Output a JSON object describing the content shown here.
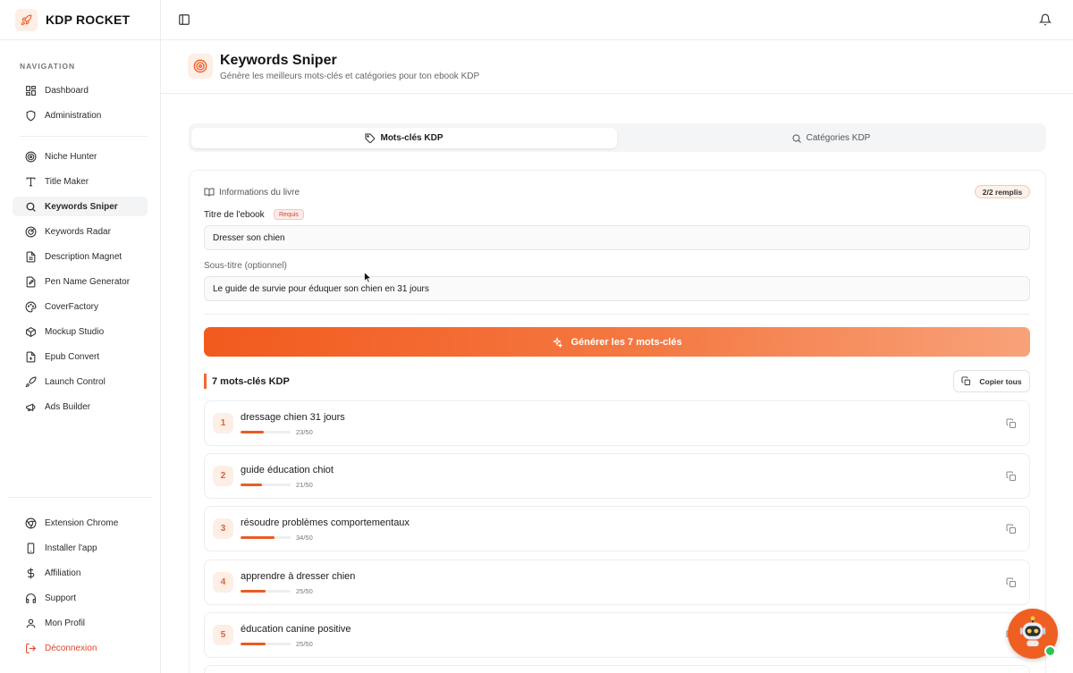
{
  "app": {
    "name": "KDP ROCKET"
  },
  "sidebar": {
    "section_label": "NAVIGATION",
    "items": [
      {
        "label": "Dashboard",
        "icon": "grid-icon"
      },
      {
        "label": "Administration",
        "icon": "shield-icon"
      },
      {
        "label": "Niche Hunter",
        "icon": "target-icon"
      },
      {
        "label": "Title Maker",
        "icon": "text-icon"
      },
      {
        "label": "Keywords Sniper",
        "icon": "search-icon"
      },
      {
        "label": "Keywords Radar",
        "icon": "radar-icon"
      },
      {
        "label": "Description Magnet",
        "icon": "file-icon"
      },
      {
        "label": "Pen Name Generator",
        "icon": "pen-icon"
      },
      {
        "label": "CoverFactory",
        "icon": "palette-icon"
      },
      {
        "label": "Mockup Studio",
        "icon": "box-icon"
      },
      {
        "label": "Epub Convert",
        "icon": "file-convert-icon"
      },
      {
        "label": "Launch Control",
        "icon": "rocket-icon"
      },
      {
        "label": "Ads Builder",
        "icon": "megaphone-icon"
      }
    ],
    "footer_items": [
      {
        "label": "Extension Chrome",
        "icon": "chrome-icon"
      },
      {
        "label": "Installer l'app",
        "icon": "smartphone-icon"
      },
      {
        "label": "Affiliation",
        "icon": "dollar-icon"
      },
      {
        "label": "Support",
        "icon": "headphones-icon"
      },
      {
        "label": "Mon Profil",
        "icon": "user-icon"
      },
      {
        "label": "Déconnexion",
        "icon": "logout-icon"
      }
    ]
  },
  "header": {
    "title": "Keywords Sniper",
    "subtitle": "Génère les meilleurs mots-clés et catégories pour ton ebook KDP"
  },
  "tabs": [
    {
      "label": "Mots-clés KDP"
    },
    {
      "label": "Catégories KDP"
    }
  ],
  "form": {
    "section_label": "Informations du livre",
    "fill_status": "2/2 remplis",
    "title_label": "Titre de l'ebook",
    "required_badge": "Requis",
    "title_value": "Dresser son chien",
    "subtitle_label": "Sous-titre (optionnel)",
    "subtitle_value": "Le guide de survie pour éduquer son chien en 31 jours",
    "generate_label": "Générer les 7 mots-clés"
  },
  "keywords": {
    "heading": "7 mots-clés KDP",
    "copy_all_label": "Copier tous",
    "items": [
      {
        "num": "1",
        "text": "dressage chien 31 jours",
        "count": "23/50",
        "fill": 0.46
      },
      {
        "num": "2",
        "text": "guide éducation chiot",
        "count": "21/50",
        "fill": 0.42
      },
      {
        "num": "3",
        "text": "résoudre problèmes comportementaux",
        "count": "34/50",
        "fill": 0.68
      },
      {
        "num": "4",
        "text": "apprendre à dresser chien",
        "count": "25/50",
        "fill": 0.5
      },
      {
        "num": "5",
        "text": "éducation canine positive",
        "count": "25/50",
        "fill": 0.5
      }
    ]
  },
  "colors": {
    "accent": "#f05f22",
    "danger": "#e0442f",
    "online": "#2fc15a"
  }
}
